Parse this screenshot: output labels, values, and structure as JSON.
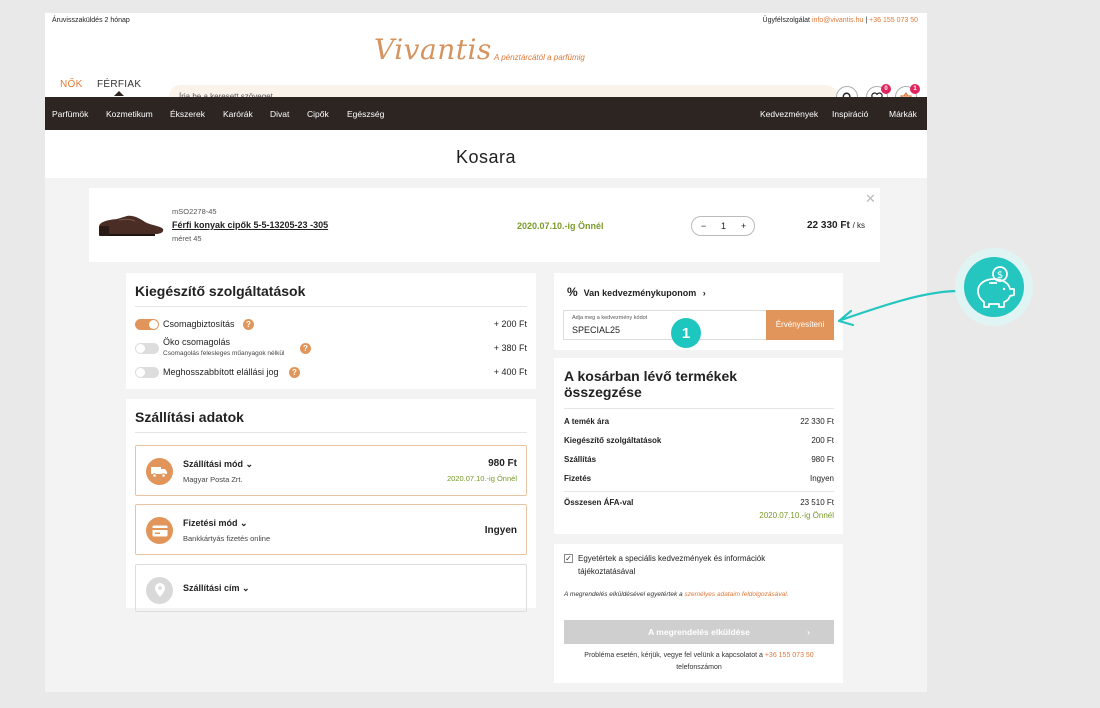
{
  "topbar": {
    "left": "Áruvisszaküldés 2 hónap",
    "service_label": "Ügyfélszolgálat",
    "email": "info@vivantis.hu",
    "separator": "|",
    "phone": "+36 155 073 50"
  },
  "header": {
    "logo": "Vivantis",
    "tagline": "A pénztárcától a parfümig",
    "gender_women": "NŐK",
    "gender_men": "FÉRFIAK",
    "search_placeholder": "Írja be a keresett szöveget",
    "wishlist_count": "0",
    "cart_count": "1"
  },
  "nav": {
    "left": [
      "Parfümök",
      "Kozmetikum",
      "Ékszerek",
      "Karórák",
      "Divat",
      "Cipők",
      "Egészség"
    ],
    "right": [
      "Kedvezmények",
      "Inspiráció",
      "Márkák"
    ]
  },
  "page_title": "Kosara",
  "product": {
    "code": "mSO2278-45",
    "name": "Férfi konyak cipők 5-5-13205-23 -305",
    "size": "méret 45",
    "delivery": "2020.07.10.-ig Önnél",
    "qty_minus": "−",
    "qty": "1",
    "qty_plus": "+",
    "price": "22 330 Ft",
    "unit": "/ ks",
    "close": "✕"
  },
  "services": {
    "title": "Kiegészítő szolgáltatások",
    "items": [
      {
        "label": "Csomagbiztosítás",
        "sub": "",
        "price": "+ 200 Ft",
        "on": true
      },
      {
        "label": "Öko csomagolás",
        "sub": "Csomagolás felesleges műanyagok nélkül",
        "price": "+ 380 Ft",
        "on": false
      },
      {
        "label": "Meghosszabbított elállási jog",
        "sub": "",
        "price": "+ 400 Ft",
        "on": false
      }
    ],
    "help": "?"
  },
  "shipping": {
    "title": "Szállítási adatok",
    "method": {
      "title": "Szállítási mód",
      "sub": "Magyar Posta Zrt.",
      "price": "980 Ft",
      "date": "2020.07.10.-ig Önnél"
    },
    "payment": {
      "title": "Fizetési mód",
      "sub": "Bankkártyás fizetés online",
      "price": "Ingyen"
    },
    "address": {
      "title": "Szállítási cím"
    }
  },
  "coupon": {
    "title": "Van kedvezménykuponom",
    "percent_icon": "%",
    "field_label": "Adja meg a kedvezmény kódot",
    "field_value": "SPECIAL25",
    "button": "Érvényesíteni",
    "step": "1"
  },
  "summary": {
    "title": "A kosárban lévő termékek összegzése",
    "rows": [
      {
        "label": "A temék ára",
        "value": "22 330 Ft"
      },
      {
        "label": "Kiegészítő szolgáltatások",
        "value": "200 Ft"
      },
      {
        "label": "Szállítás",
        "value": "980 Ft"
      },
      {
        "label": "Fizetés",
        "value": "Ingyen"
      }
    ],
    "total_label": "Összesen ÁFA-val",
    "total_value": "23 510 Ft",
    "total_date": "2020.07.10.-ig Önnél"
  },
  "consent": {
    "check": "✓",
    "text": "Egyetértek a speciális kedvezmények és információk tájékoztatásával",
    "legal_prefix": "A megrendelés elküldésével egyetértek a",
    "legal_link": "személyes adataim feldolgozásával.",
    "send_button": "A megrendelés elküldése",
    "send_chevron": "›",
    "help_prefix": "Probléma esetén, kérjük, vegye fel velünk a kapcsolatot a",
    "help_phone": "+36 155 073 50",
    "help_suffix": "telefonszámon"
  },
  "colors": {
    "accent": "#e2955a",
    "dark": "#2c2522",
    "green": "#7a9a2a",
    "teal": "#25c5c0"
  }
}
